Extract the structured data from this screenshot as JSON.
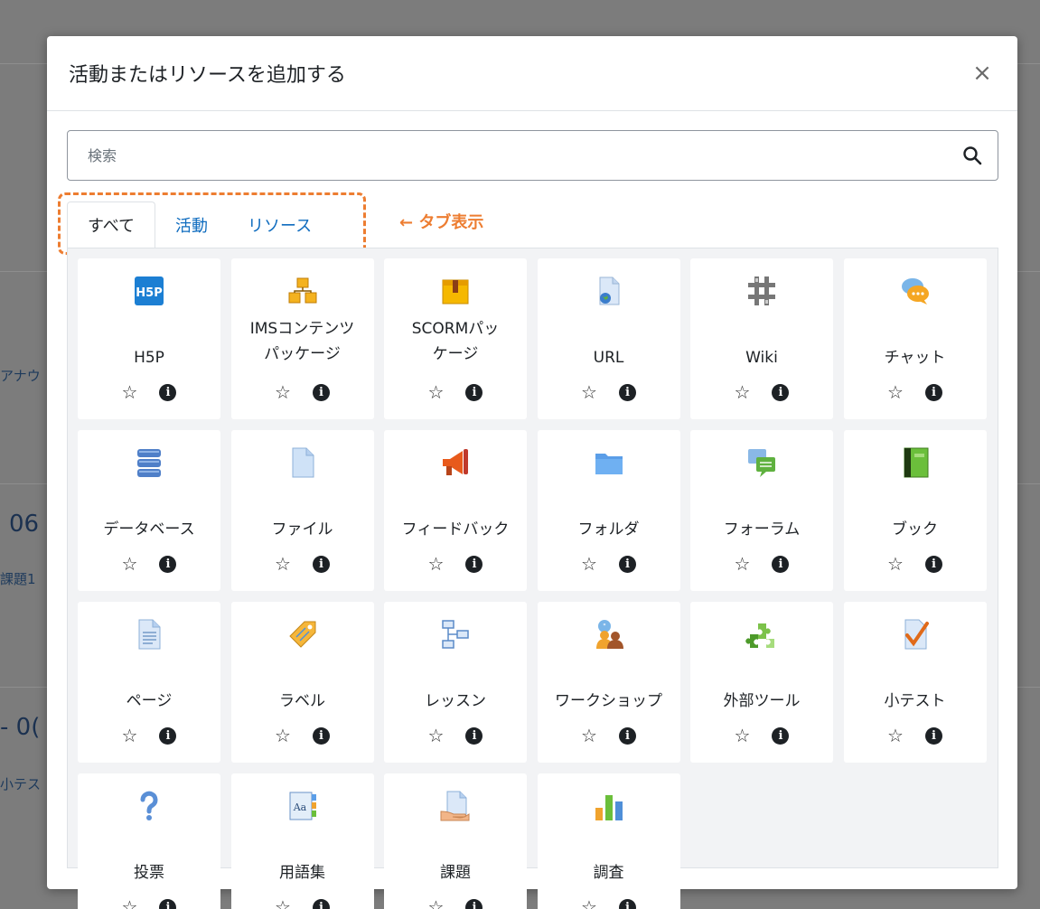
{
  "background": {
    "fragments": [
      "アナウ",
      "06",
      "課題1",
      "- 0(",
      "小テス"
    ]
  },
  "modal": {
    "title": "活動またはリソースを追加する",
    "close_label": "×",
    "search": {
      "placeholder": "検索"
    },
    "tabs": [
      {
        "label": "すべて",
        "active": true
      },
      {
        "label": "活動",
        "active": false
      },
      {
        "label": "リソース",
        "active": false
      }
    ],
    "annotation": "← タブ表示"
  },
  "items": [
    {
      "name": "H5P",
      "icon": "h5p-icon"
    },
    {
      "name": "IMSコンテンツ\nパッケージ",
      "icon": "ims-package-icon"
    },
    {
      "name": "SCORMパッ\nケージ",
      "icon": "scorm-package-icon"
    },
    {
      "name": "URL",
      "icon": "url-icon"
    },
    {
      "name": "Wiki",
      "icon": "wiki-icon"
    },
    {
      "name": "チャット",
      "icon": "chat-icon"
    },
    {
      "name": "データベース",
      "icon": "database-icon"
    },
    {
      "name": "ファイル",
      "icon": "file-icon"
    },
    {
      "name": "フィードバック",
      "icon": "feedback-icon"
    },
    {
      "name": "フォルダ",
      "icon": "folder-icon"
    },
    {
      "name": "フォーラム",
      "icon": "forum-icon"
    },
    {
      "name": "ブック",
      "icon": "book-icon"
    },
    {
      "name": "ページ",
      "icon": "page-icon"
    },
    {
      "name": "ラベル",
      "icon": "label-icon"
    },
    {
      "name": "レッスン",
      "icon": "lesson-icon"
    },
    {
      "name": "ワークショップ",
      "icon": "workshop-icon"
    },
    {
      "name": "外部ツール",
      "icon": "external-tool-icon"
    },
    {
      "name": "小テスト",
      "icon": "quiz-icon"
    },
    {
      "name": "投票",
      "icon": "choice-icon"
    },
    {
      "name": "用語集",
      "icon": "glossary-icon"
    },
    {
      "name": "課題",
      "icon": "assignment-icon"
    },
    {
      "name": "調査",
      "icon": "survey-icon"
    }
  ],
  "actions": {
    "star": "☆",
    "info": "i"
  },
  "colors": {
    "accent": "#0f6cbf",
    "annotation": "#ed7d31",
    "grid_bg": "#f2f3f5"
  }
}
